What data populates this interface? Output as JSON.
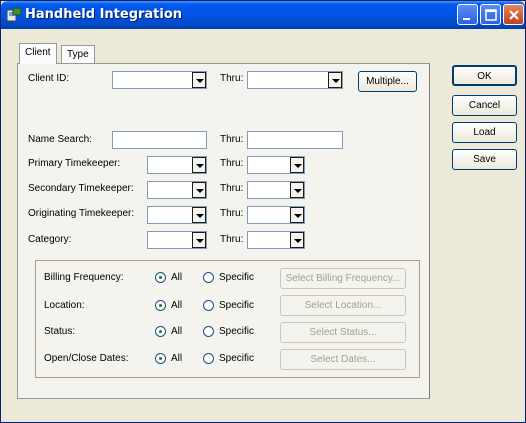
{
  "window": {
    "title": "Handheld Integration"
  },
  "tabs": [
    {
      "label": "Client"
    },
    {
      "label": "Type"
    }
  ],
  "fields": {
    "client_id": {
      "label": "Client ID:",
      "thru_label": "Thru:",
      "multiple_button": "Multiple..."
    },
    "name_search": {
      "label": "Name Search:",
      "thru_label": "Thru:"
    },
    "primary_timekeeper": {
      "label": "Primary Timekeeper:",
      "thru_label": "Thru:"
    },
    "secondary_timekeeper": {
      "label": "Secondary Timekeeper:",
      "thru_label": "Thru:"
    },
    "originating_timekeeper": {
      "label": "Originating Timekeeper:",
      "thru_label": "Thru:"
    },
    "category": {
      "label": "Category:",
      "thru_label": "Thru:"
    }
  },
  "filters": [
    {
      "label": "Billing Frequency:",
      "all": "All",
      "specific": "Specific",
      "selected": "All",
      "button": "Select Billing Frequency..."
    },
    {
      "label": "Location:",
      "all": "All",
      "specific": "Specific",
      "selected": "All",
      "button": "Select Location..."
    },
    {
      "label": "Status:",
      "all": "All",
      "specific": "Specific",
      "selected": "All",
      "button": "Select Status..."
    },
    {
      "label": "Open/Close Dates:",
      "all": "All",
      "specific": "Specific",
      "selected": "All",
      "button": "Select Dates..."
    }
  ],
  "actions": {
    "ok": "OK",
    "cancel": "Cancel",
    "load": "Load",
    "save": "Save"
  }
}
